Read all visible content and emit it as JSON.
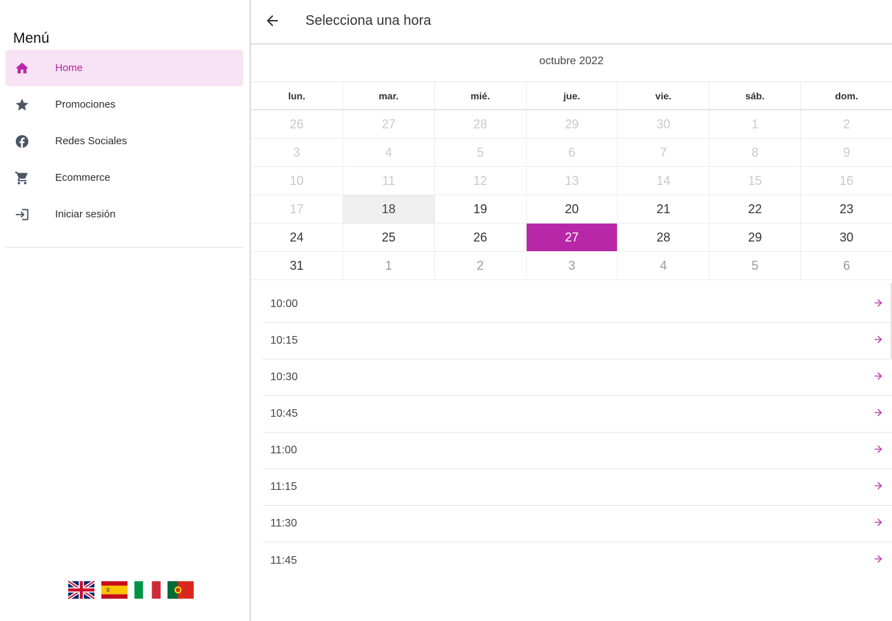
{
  "sidebar": {
    "title": "Menú",
    "items": [
      {
        "label": "Home",
        "icon": "home-icon",
        "active": true
      },
      {
        "label": "Promociones",
        "icon": "star-icon"
      },
      {
        "label": "Redes Sociales",
        "icon": "facebook-icon"
      },
      {
        "label": "Ecommerce",
        "icon": "cart-icon"
      },
      {
        "label": "Iniciar sesión",
        "icon": "login-icon"
      }
    ],
    "flags": [
      "uk-flag-icon",
      "spain-flag-icon",
      "italy-flag-icon",
      "portugal-flag-icon"
    ]
  },
  "header": {
    "back_icon": "arrow-back-icon",
    "title": "Selecciona una hora"
  },
  "calendar": {
    "month": "octubre 2022",
    "weekdays": [
      "lun.",
      "mar.",
      "mié.",
      "jue.",
      "vie.",
      "sáb.",
      "dom."
    ],
    "weeks": [
      [
        "26",
        "27",
        "28",
        "29",
        "30",
        "1",
        "2"
      ],
      [
        "3",
        "4",
        "5",
        "6",
        "7",
        "8",
        "9"
      ],
      [
        "10",
        "11",
        "12",
        "13",
        "14",
        "15",
        "16"
      ],
      [
        "17",
        "18",
        "19",
        "20",
        "21",
        "22",
        "23"
      ],
      [
        "24",
        "25",
        "26",
        "27",
        "28",
        "29",
        "30"
      ],
      [
        "31",
        "1",
        "2",
        "3",
        "4",
        "5",
        "6"
      ]
    ],
    "today": "18",
    "selected": "27"
  },
  "slots": [
    "10:00",
    "10:15",
    "10:30",
    "10:45",
    "11:00",
    "11:15",
    "11:30",
    "11:45"
  ],
  "colors": {
    "accent": "#b827a8",
    "active_bg": "#f7e3f3",
    "today_bg": "#efefef",
    "icon_gray": "#5f6368"
  }
}
